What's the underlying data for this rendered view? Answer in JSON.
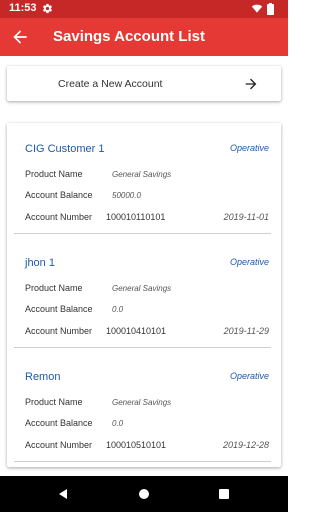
{
  "status_bar": {
    "time": "11:53"
  },
  "app_bar": {
    "title": "Savings Account List"
  },
  "create_account": {
    "label": "Create a New Account"
  },
  "row_labels": {
    "product_name": "Product Name",
    "account_balance": "Account Balance",
    "account_number": "Account Number"
  },
  "accounts": [
    {
      "name": "CIG Customer  1",
      "status": "Operative",
      "product_name": "General Savings",
      "balance": "50000.0",
      "number": "100010110101",
      "date": "2019-11-01"
    },
    {
      "name": "jhon  1",
      "status": "Operative",
      "product_name": "General Savings",
      "balance": "0.0",
      "number": "100010410101",
      "date": "2019-11-29"
    },
    {
      "name": "Remon",
      "status": "Operative",
      "product_name": "General Savings",
      "balance": "0.0",
      "number": "100010510101",
      "date": "2019-12-28"
    }
  ],
  "colors": {
    "status_bar": "#c62828",
    "app_bar": "#e53935",
    "accent_text": "#1e5aa8"
  },
  "icons": {
    "status": [
      "gear-icon",
      "wifi-icon",
      "battery-icon"
    ],
    "app_bar": "back-arrow-icon",
    "create": "arrow-right-icon",
    "nav": [
      "nav-back-icon",
      "nav-home-icon",
      "nav-recents-icon"
    ]
  }
}
